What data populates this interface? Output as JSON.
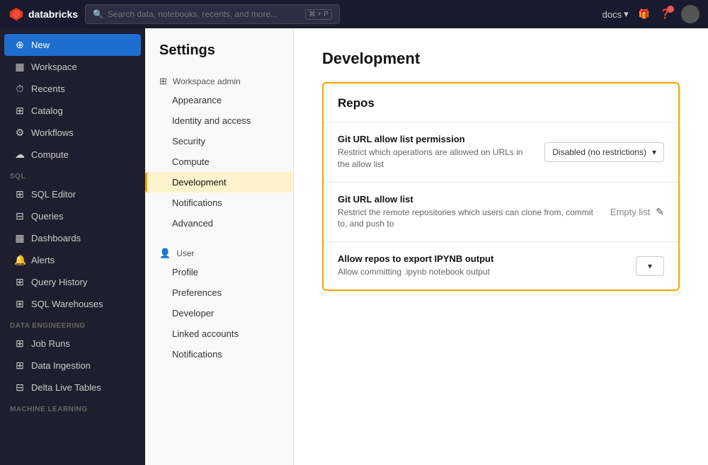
{
  "topbar": {
    "brand": "databricks",
    "search_placeholder": "Search data, notebooks, recents, and more...",
    "search_shortcut": "⌘ + P",
    "docs_label": "docs",
    "chevron": "▾"
  },
  "sidebar": {
    "new_label": "New",
    "items": [
      {
        "id": "workspace",
        "label": "Workspace",
        "icon": "▦"
      },
      {
        "id": "recents",
        "label": "Recents",
        "icon": "⏱"
      },
      {
        "id": "catalog",
        "label": "Catalog",
        "icon": "⊞"
      },
      {
        "id": "workflows",
        "label": "Workflows",
        "icon": "⚙"
      },
      {
        "id": "compute",
        "label": "Compute",
        "icon": "☁"
      }
    ],
    "sql_section": "SQL",
    "sql_items": [
      {
        "id": "sql-editor",
        "label": "SQL Editor",
        "icon": "⊞"
      },
      {
        "id": "queries",
        "label": "Queries",
        "icon": "⊟"
      },
      {
        "id": "dashboards",
        "label": "Dashboards",
        "icon": "▦"
      },
      {
        "id": "alerts",
        "label": "Alerts",
        "icon": "🔔"
      },
      {
        "id": "query-history",
        "label": "Query History",
        "icon": "⊞"
      },
      {
        "id": "sql-warehouses",
        "label": "SQL Warehouses",
        "icon": "⊞"
      }
    ],
    "data_engineering_section": "Data Engineering",
    "de_items": [
      {
        "id": "job-runs",
        "label": "Job Runs",
        "icon": "⊞"
      },
      {
        "id": "data-ingestion",
        "label": "Data Ingestion",
        "icon": "⊞"
      },
      {
        "id": "delta-live-tables",
        "label": "Delta Live Tables",
        "icon": "⊟"
      }
    ],
    "ml_section": "Machine Learning"
  },
  "settings": {
    "title": "Settings",
    "workspace_admin_label": "Workspace admin",
    "workspace_admin_icon": "⊞",
    "workspace_admin_items": [
      {
        "id": "appearance",
        "label": "Appearance"
      },
      {
        "id": "identity-and-access",
        "label": "Identity and access"
      },
      {
        "id": "security",
        "label": "Security"
      },
      {
        "id": "compute",
        "label": "Compute"
      },
      {
        "id": "development",
        "label": "Development",
        "active": true
      },
      {
        "id": "notifications",
        "label": "Notifications"
      },
      {
        "id": "advanced",
        "label": "Advanced"
      }
    ],
    "user_label": "User",
    "user_icon": "👤",
    "user_items": [
      {
        "id": "profile",
        "label": "Profile"
      },
      {
        "id": "preferences",
        "label": "Preferences"
      },
      {
        "id": "developer",
        "label": "Developer"
      },
      {
        "id": "linked-accounts",
        "label": "Linked accounts"
      },
      {
        "id": "user-notifications",
        "label": "Notifications"
      }
    ]
  },
  "content": {
    "title": "Development",
    "repos_section_title": "Repos",
    "settings_rows": [
      {
        "id": "git-url-permission",
        "label": "Git URL allow list permission",
        "desc": "Restrict which operations are allowed on URLs in the allow list",
        "control_type": "dropdown",
        "control_value": "Disabled (no restrictions)"
      },
      {
        "id": "git-url-allow-list",
        "label": "Git URL allow list",
        "desc": "Restrict the remote repositories which users can clone from, commit to, and push to",
        "control_type": "empty-list",
        "control_value": "Empty list"
      },
      {
        "id": "allow-ipynb",
        "label": "Allow repos to export IPYNB output",
        "desc": "Allow committing .ipynb notebook output",
        "control_type": "dropdown-sm",
        "control_value": ""
      }
    ]
  }
}
